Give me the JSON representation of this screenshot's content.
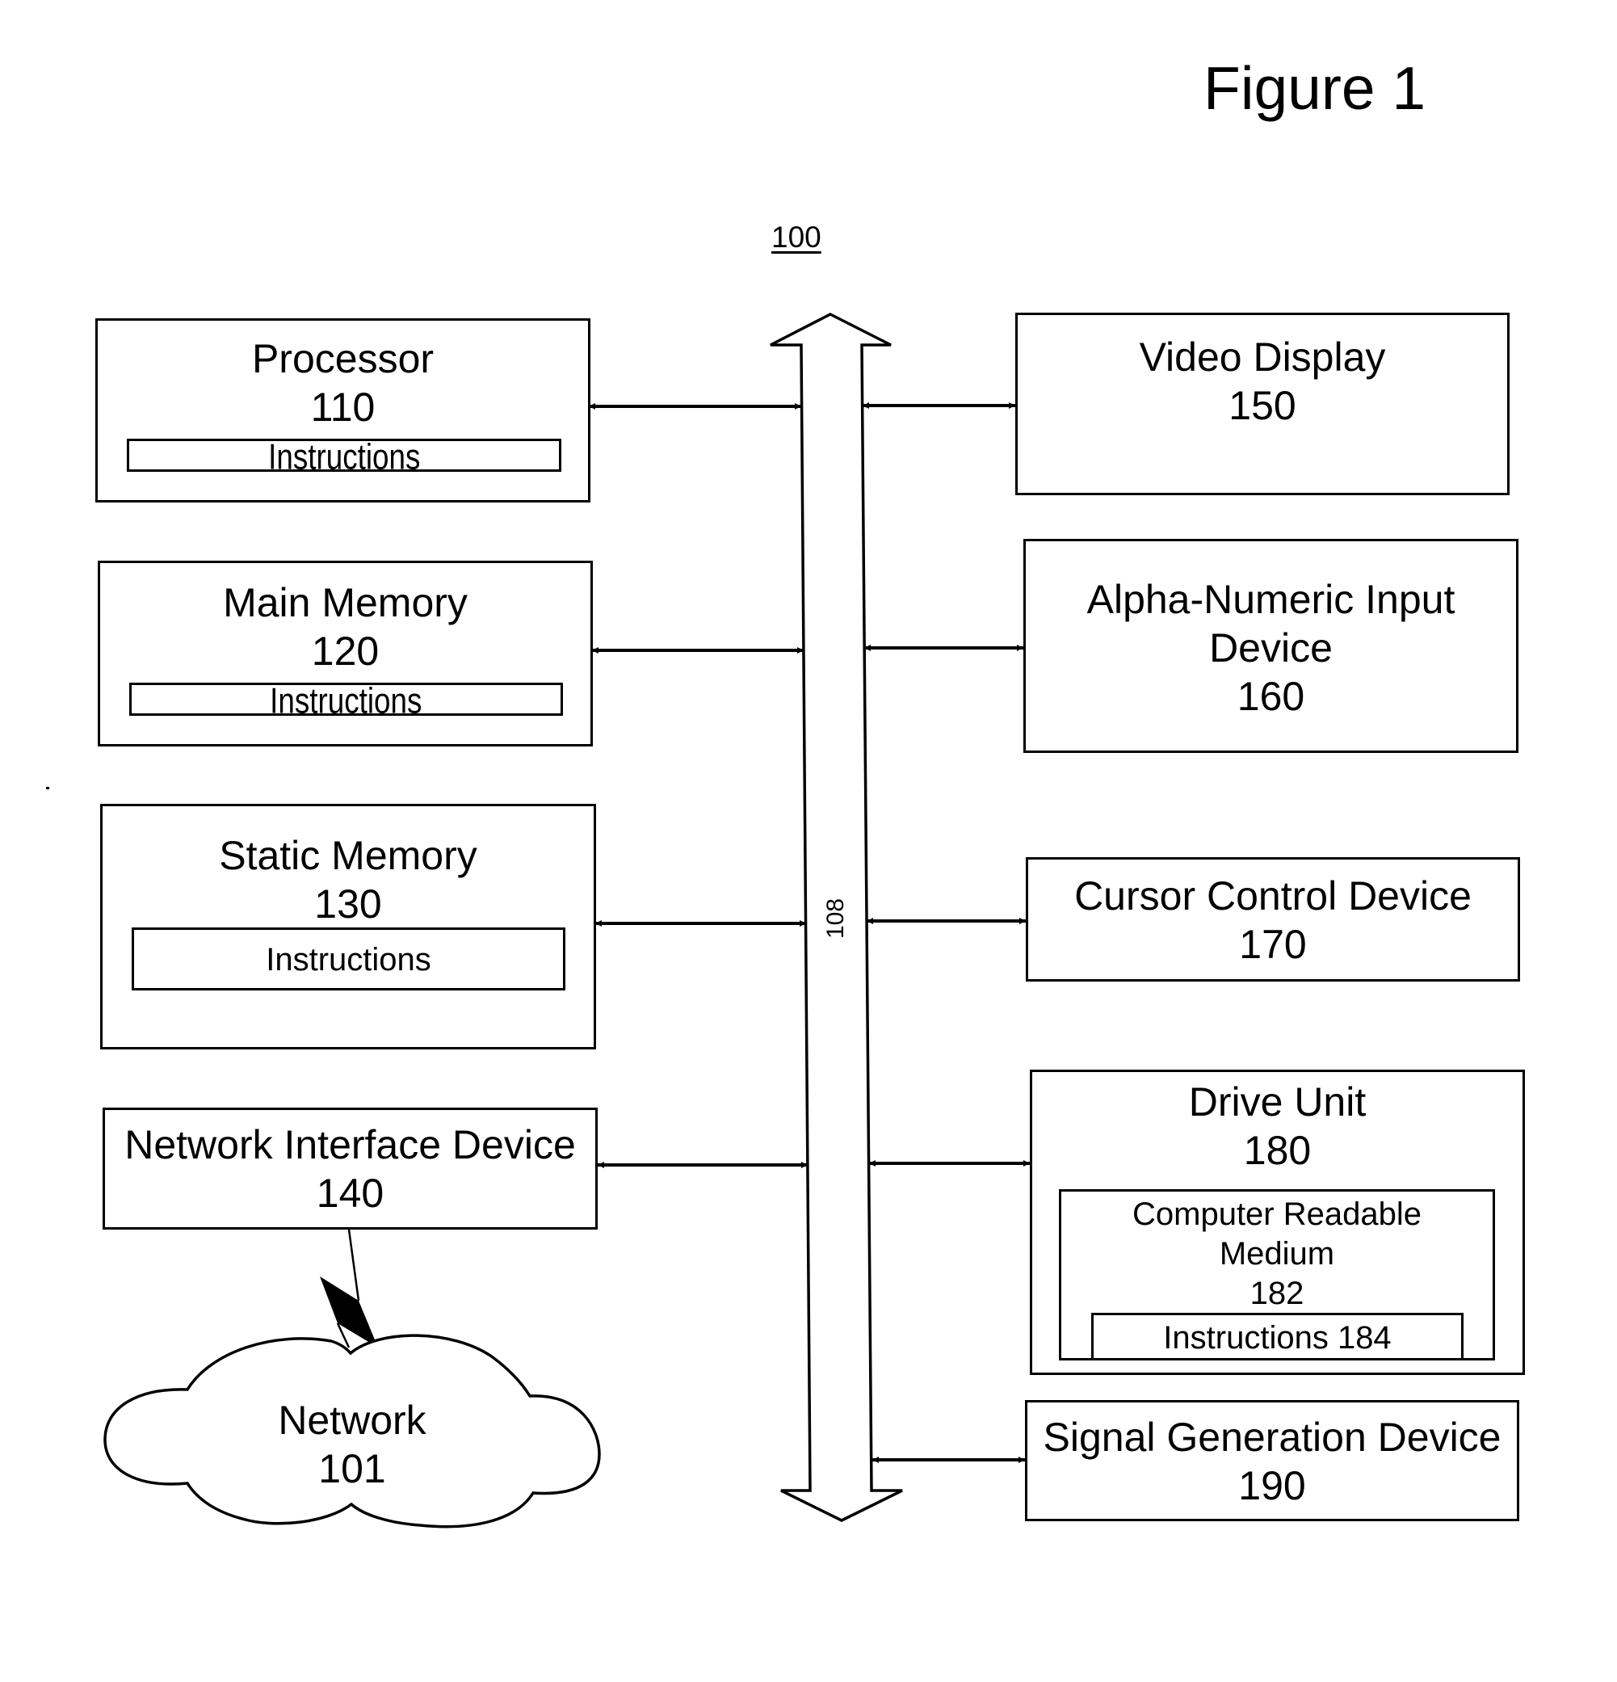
{
  "figure": {
    "title": "Figure 1",
    "reference": "100",
    "bus": {
      "label": "108"
    }
  },
  "left_column": [
    {
      "id": "processor",
      "title": "Processor",
      "ref": "110",
      "sub": {
        "label": "Instructions"
      }
    },
    {
      "id": "main-memory",
      "title": "Main Memory",
      "ref": "120",
      "sub": {
        "label": "Instructions"
      }
    },
    {
      "id": "static-memory",
      "title": "Static Memory",
      "ref": "130",
      "sub": {
        "label": "Instructions"
      }
    },
    {
      "id": "network-interface-device",
      "title": "Network Interface Device",
      "ref": "140"
    }
  ],
  "right_column": [
    {
      "id": "video-display",
      "title": "Video Display",
      "ref": "150"
    },
    {
      "id": "alpha-numeric-input-device",
      "title_line1": "Alpha-Numeric Input",
      "title_line2": "Device",
      "ref": "160"
    },
    {
      "id": "cursor-control-device",
      "title": "Cursor Control Device",
      "ref": "170"
    },
    {
      "id": "drive-unit",
      "title": "Drive Unit",
      "ref": "180",
      "medium": {
        "line1": "Computer Readable",
        "line2": "Medium",
        "ref": "182",
        "instructions": "Instructions 184"
      }
    },
    {
      "id": "signal-generation-device",
      "title": "Signal Generation Device",
      "ref": "190"
    }
  ],
  "network": {
    "title": "Network",
    "ref": "101"
  },
  "connections": [
    {
      "from": "processor",
      "to": "bus",
      "type": "bidirectional"
    },
    {
      "from": "main-memory",
      "to": "bus",
      "type": "bidirectional"
    },
    {
      "from": "static-memory",
      "to": "bus",
      "type": "bidirectional"
    },
    {
      "from": "network-interface-device",
      "to": "bus",
      "type": "bidirectional"
    },
    {
      "from": "bus",
      "to": "video-display",
      "type": "bidirectional"
    },
    {
      "from": "bus",
      "to": "alpha-numeric-input-device",
      "type": "bidirectional"
    },
    {
      "from": "bus",
      "to": "cursor-control-device",
      "type": "bidirectional"
    },
    {
      "from": "bus",
      "to": "drive-unit",
      "type": "bidirectional"
    },
    {
      "from": "bus",
      "to": "signal-generation-device",
      "type": "bidirectional"
    },
    {
      "from": "network-interface-device",
      "to": "network",
      "type": "wireless"
    }
  ]
}
